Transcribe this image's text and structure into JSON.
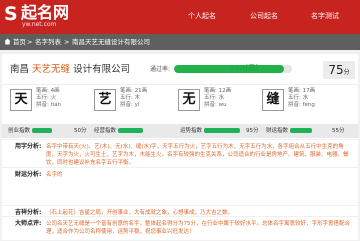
{
  "logo": {
    "mark": "S",
    "text": "起名网",
    "url": "yw.net.com"
  },
  "nav": [
    "个人起名",
    "公司起名",
    "名字测试"
  ],
  "breadcrumb": [
    "首页",
    "名字列表",
    "南昌天艺无缝设计有限公司"
  ],
  "company": {
    "city": "南昌",
    "brand": "天艺无缝",
    "suffix": "设计有限公司"
  },
  "pass": {
    "label": "通过率:",
    "percent": 93,
    "text": "93%[高]"
  },
  "score": {
    "value": "75",
    "unit": "分"
  },
  "chars": [
    {
      "char": "天",
      "bihua": "笔画: 4画",
      "wuxing": "五行: 火",
      "pinyin": "拼音: tian"
    },
    {
      "char": "艺",
      "bihua": "笔画: 21画",
      "wuxing": "五行: 木",
      "pinyin": "拼音: yi"
    },
    {
      "char": "无",
      "bihua": "笔画: 12画",
      "wuxing": "五行: 水",
      "pinyin": "拼音: wu"
    },
    {
      "char": "缝",
      "bihua": "笔画: 17画",
      "wuxing": "五行: 水",
      "pinyin": "拼音: feng"
    }
  ],
  "score_rows": [
    {
      "label": "创业指数",
      "value": "50分",
      "level": 0.5
    },
    {
      "label": "经营指数",
      "value": "",
      "level": 0.63
    },
    {
      "label": "运势指数",
      "value": "95分",
      "level": 0.9
    },
    {
      "label": "财运指数",
      "value": "55分",
      "level": 0.55
    }
  ],
  "sections": [
    {
      "label": "用字分析:",
      "text": "名字中带有天(火)、艺(木)、无(水)、缝(水)字，天字五行为火，艺字五行为木，无字五行为水，各字组合从五行中生克的角度，天字为火，火可生土，艺字为木，木能生火，名字有较强的生克关系，公司适合的行业是房地产、建筑、服装、电器、餐饮，同时也建议补充名字五行平衡。"
    },
    {
      "label": "财运分析:",
      "text": "名字的"
    },
    {
      "label": "吉祥分析:",
      "text": "（石上起花）吉星之局，开创事业，大有成就之象，心想事成，乃大吉之数。"
    },
    {
      "label": "大师点评:",
      "text": "公司名天艺无缝是一个富有创意的名字，整体起名得分为75分，在行业中属于较好水平。总体名字寓意较好，字形字意搭配合理，适合作为公司名称使用，运势平稳，祝您事业兴旺发达！"
    }
  ]
}
